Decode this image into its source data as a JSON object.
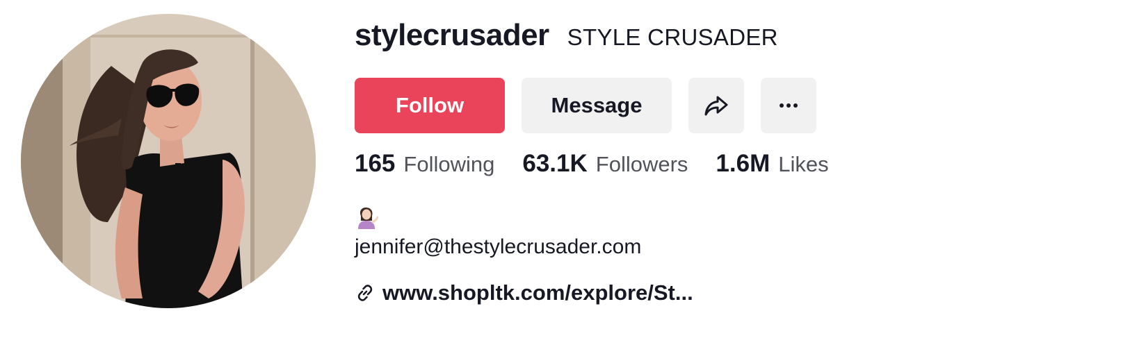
{
  "profile": {
    "username": "stylecrusader",
    "nickname": "STYLE CRUSADER",
    "avatar_alt": "profile-photo"
  },
  "actions": {
    "follow_label": "Follow",
    "message_label": "Message",
    "share_icon": "share-icon",
    "more_icon": "more-icon"
  },
  "stats": [
    {
      "count": "165",
      "label": "Following"
    },
    {
      "count": "63.1K",
      "label": "Followers"
    },
    {
      "count": "1.6M",
      "label": "Likes"
    }
  ],
  "bio": {
    "emoji": "person-tipping-hand-emoji",
    "email": "jennifer@thestylecrusader.com"
  },
  "link": {
    "icon": "link-icon",
    "text": "www.shopltk.com/explore/St..."
  },
  "colors": {
    "follow_bg": "#ea445a",
    "button_bg": "#f1f1f2",
    "text": "#161823"
  }
}
